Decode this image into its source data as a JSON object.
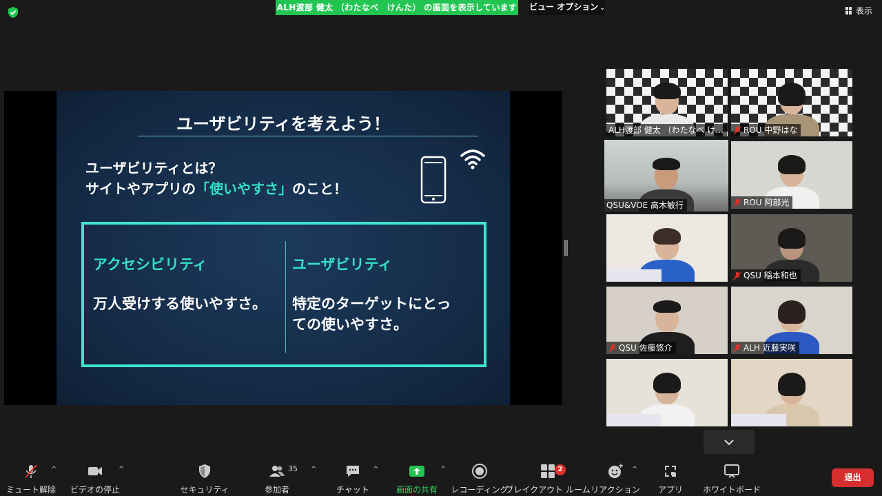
{
  "top": {
    "share_banner": "ALH渡部 健太 （わたなべ　けんた） の画面を表示しています",
    "view_options": "ビュー オプション",
    "display_label": "表示"
  },
  "slide": {
    "title": "ユーザビリティを考えよう！",
    "definition_line1": "ユーザビリティとは？",
    "definition_line2_pre": "サイトやアプリの",
    "definition_line2_highlight": "「使いやすさ」",
    "definition_line2_post": "のこと！",
    "left_heading": "アクセシビリティ",
    "left_body": "万人受けする使いやすさ。",
    "right_heading": "ユーザビリティ",
    "right_body_line1": "特定のターゲットにとっ",
    "right_body_line2": "ての使いやすさ。"
  },
  "participants": [
    {
      "name": "ALH渡部 健太 （わたなべ け...",
      "muted": false
    },
    {
      "name": "ROU 中野はな",
      "muted": true
    },
    {
      "name": "QSU&VOE 高木敏行",
      "muted": false,
      "active_speaker": true
    },
    {
      "name": "ROU 阿部光",
      "muted": true
    },
    {
      "name": "",
      "muted": false
    },
    {
      "name": "QSU 稲本和也",
      "muted": true
    },
    {
      "name": "QSU 佐藤悠介",
      "muted": true
    },
    {
      "name": "ALH 近藤実咲",
      "muted": true
    },
    {
      "name": "",
      "muted": false
    },
    {
      "name": "",
      "muted": false
    }
  ],
  "toolbar": {
    "unmute": "ミュート解除",
    "stop_video": "ビデオの停止",
    "security": "セキュリティ",
    "participants": "参加者",
    "participants_count": "35",
    "chat": "チャット",
    "share_screen": "画面の共有",
    "recording": "レコーディング",
    "breakout": "ブレイクアウト ルーム",
    "breakout_badge": "2",
    "reactions": "リアクション",
    "apps": "アプリ",
    "whiteboard": "ホワイトボード",
    "leave": "退出"
  },
  "colors": {
    "share_green": "#23c552",
    "slide_accent": "#3fe3cf",
    "leave_red": "#d52f2f",
    "active_speaker": "#e6e85a"
  }
}
